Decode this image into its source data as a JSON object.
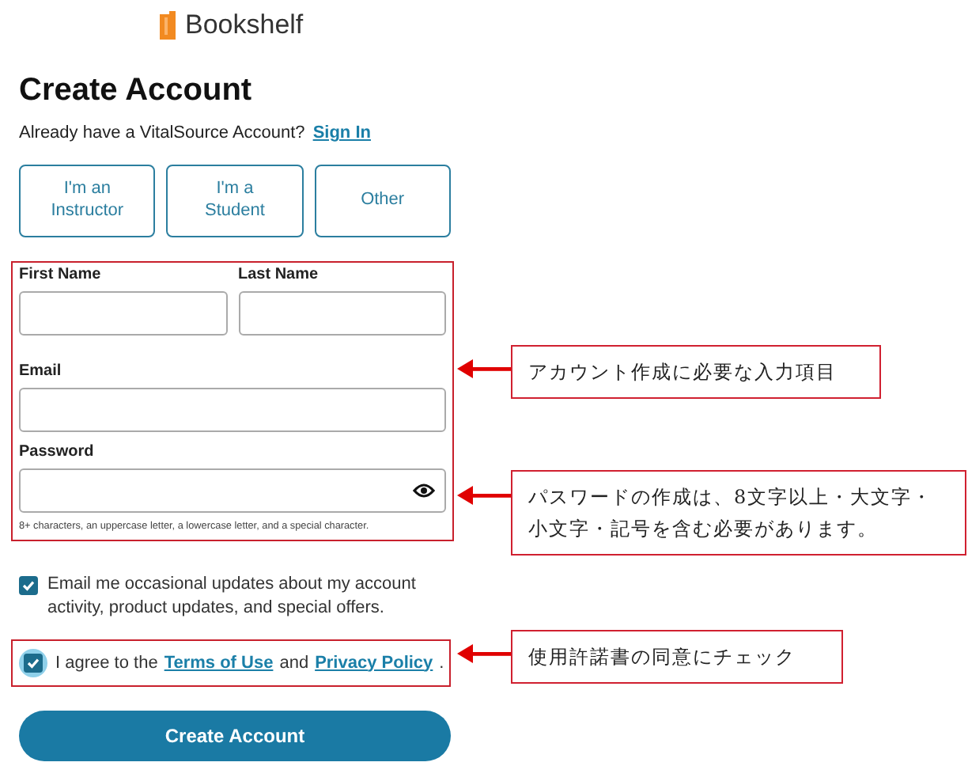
{
  "logo": {
    "text": "Bookshelf"
  },
  "title": "Create Account",
  "signin_prompt": {
    "text": "Already have a VitalSource Account?",
    "link": "Sign In"
  },
  "roles": [
    {
      "label": "I'm an\nInstructor",
      "selected": false
    },
    {
      "label": "I'm a\nStudent",
      "selected": false
    },
    {
      "label": "Other",
      "selected": false
    }
  ],
  "fields": [
    {
      "label": "First Name"
    },
    {
      "label": "Last Name"
    },
    {
      "label": "Email"
    },
    {
      "label": "Password",
      "hint": "8+ characters, an uppercase letter, a lowercase letter, and a special character."
    }
  ],
  "options": [
    {
      "kind": "plain",
      "checked": true,
      "focused": false,
      "text": "Email me occasional updates about my account activity, product updates, and special offers."
    },
    {
      "kind": "terms",
      "checked": true,
      "focused": true,
      "parts": [
        "I agree to the",
        "Terms of Use",
        "and",
        "Privacy Policy",
        "."
      ]
    }
  ],
  "submit": "Create Account",
  "annotations": [
    {
      "text": "アカウント作成に必要な入力項目"
    },
    {
      "text": "パスワードの作成は、8文字以上・大文字・小文字・記号を含む必要があります。"
    },
    {
      "text": "使用許諾書の同意にチェック"
    }
  ]
}
